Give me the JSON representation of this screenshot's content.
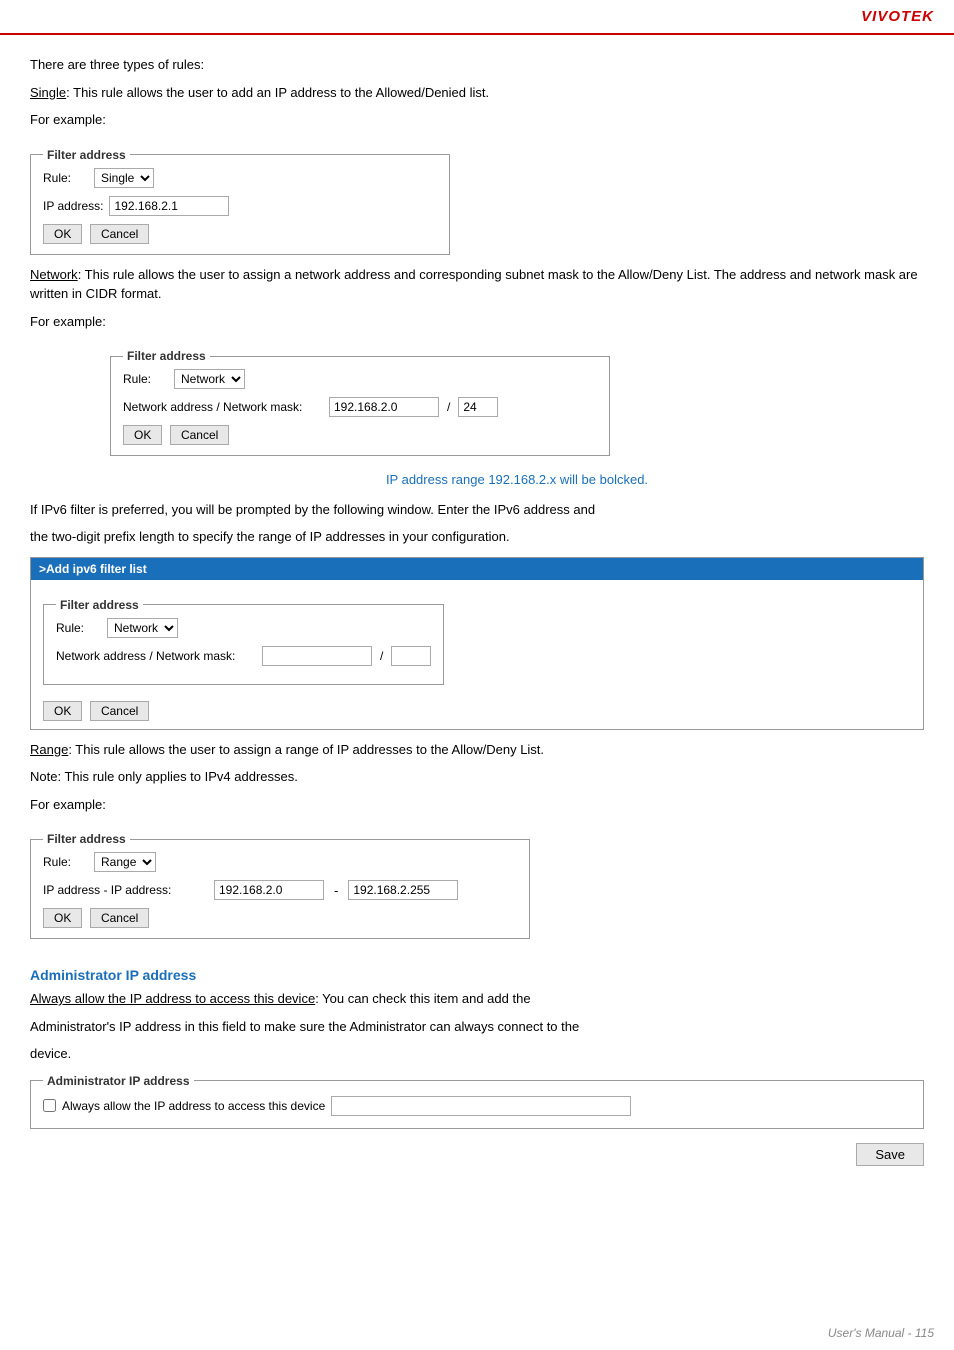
{
  "header": {
    "brand": "VIVOTEK"
  },
  "footer": {
    "text": "User's Manual - 115"
  },
  "content": {
    "intro": {
      "line1": "There are three types of rules:",
      "single_label": "Single",
      "single_desc": ": This rule allows the user to add an IP address to the Allowed/Denied list.",
      "for_example": "For example:"
    },
    "single_filter": {
      "legend": "Filter address",
      "rule_label": "Rule:",
      "rule_value": "Single",
      "ip_label": "IP address:",
      "ip_value": "192.168.2.1",
      "ok_label": "OK",
      "cancel_label": "Cancel"
    },
    "network_desc": {
      "network_label": "Network",
      "desc": ": This rule allows the user to assign a network address and corresponding subnet mask to the Allow/Deny List. The address and network mask are written in CIDR format.",
      "for_example": "For example:"
    },
    "network_filter": {
      "legend": "Filter address",
      "rule_label": "Rule:",
      "rule_value": "Network",
      "net_addr_label": "Network address / Network mask:",
      "net_addr_value": "192.168.2.0",
      "mask_value": "24",
      "ok_label": "OK",
      "cancel_label": "Cancel"
    },
    "ip_range_note": "IP address range 192.168.2.x will be bolcked.",
    "ipv6_desc": {
      "line1": "If IPv6 filter is preferred, you will be prompted by the following window. Enter the IPv6 address and",
      "line2": "the two-digit prefix length to specify the range of IP addresses in your configuration."
    },
    "ipv6_bar": ">Add ipv6 filter list",
    "ipv6_filter": {
      "legend": "Filter address",
      "rule_label": "Rule:",
      "rule_value": "Network",
      "net_addr_label": "Network address / Network mask:",
      "net_addr_value": "",
      "mask_value": "",
      "ok_label": "OK",
      "cancel_label": "Cancel"
    },
    "range_desc": {
      "range_label": "Range",
      "desc": ": This rule allows the user to assign a range of IP addresses to the Allow/Deny List.",
      "note_label": "Note",
      "note_desc": ": This rule only applies to IPv4 addresses.",
      "for_example": "For example:"
    },
    "range_filter": {
      "legend": "Filter address",
      "rule_label": "Rule:",
      "rule_value": "Range",
      "ip_addr_label": "IP address - IP address:",
      "ip_from": "192.168.2.0",
      "dash": "-",
      "ip_to": "192.168.2.255",
      "ok_label": "OK",
      "cancel_label": "Cancel"
    },
    "admin_section": {
      "title": "Administrator IP address",
      "always_label": "Always allow the IP address to access this device",
      "desc_line1": "Always allow the IP address to access this device",
      "desc_colon": ": You can check this item and add the",
      "desc_line2": "Administrator's IP address in this field to make sure the Administrator can always connect to the",
      "desc_line3": "device.",
      "legend": "Administrator IP address",
      "checkbox_label": "Always allow the IP address to access this device",
      "ip_value": "",
      "save_label": "Save"
    }
  }
}
